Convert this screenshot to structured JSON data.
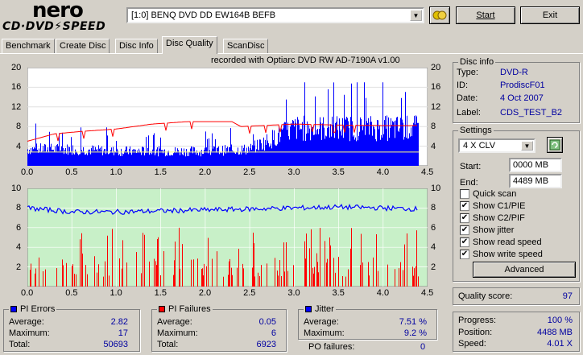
{
  "logo": {
    "top": "nero",
    "bottom": "CD·DVD⚡SPEED"
  },
  "drive": {
    "selected": "[1:0]  BENQ DVD DD EW164B BEFB"
  },
  "buttons": {
    "start": "Start",
    "exit": "Exit",
    "advanced": "Advanced"
  },
  "tabs": [
    "Benchmark",
    "Create Disc",
    "Disc Info",
    "Disc Quality",
    "ScanDisc"
  ],
  "chart_header": "recorded with Optiarc  DVD RW AD-7190A   v1.00",
  "disc_info": {
    "title": "Disc info",
    "type_label": "Type:",
    "type_value": "DVD-R",
    "id_label": "ID:",
    "id_value": "ProdiscF01",
    "date_label": "Date:",
    "date_value": "4 Oct 2007",
    "label_label": "Label:",
    "label_value": "CDS_TEST_B2"
  },
  "settings": {
    "title": "Settings",
    "speed": "4 X CLV",
    "start_label": "Start:",
    "start_value": "0000 MB",
    "end_label": "End:",
    "end_value": "4489 MB",
    "checks": [
      {
        "label": "Quick scan",
        "checked": false
      },
      {
        "label": "Show C1/PIE",
        "checked": true
      },
      {
        "label": "Show C2/PIF",
        "checked": true
      },
      {
        "label": "Show jitter",
        "checked": true
      },
      {
        "label": "Show read speed",
        "checked": true
      },
      {
        "label": "Show write speed",
        "checked": true
      }
    ]
  },
  "quality": {
    "label": "Quality score:",
    "value": "97"
  },
  "progress": {
    "progress_label": "Progress:",
    "progress_value": "100 %",
    "position_label": "Position:",
    "position_value": "4488 MB",
    "speed_label": "Speed:",
    "speed_value": "4.01 X"
  },
  "pi_errors": {
    "title": "PI Errors",
    "avg_label": "Average:",
    "avg": "2.82",
    "max_label": "Maximum:",
    "max": "17",
    "total_label": "Total:",
    "total": "50693",
    "color": "#0000ff"
  },
  "pi_failures": {
    "title": "PI Failures",
    "avg_label": "Average:",
    "avg": "0.05",
    "max_label": "Maximum:",
    "max": "6",
    "total_label": "Total:",
    "total": "6923",
    "color": "#ff0000"
  },
  "jitter": {
    "title": "Jitter",
    "avg_label": "Average:",
    "avg": "7.51 %",
    "max_label": "Maximum:",
    "max": "9.2 %",
    "po_label": "PO failures:",
    "po": "0",
    "color": "#0000ff"
  },
  "chart_data": [
    {
      "type": "area",
      "name": "PI Errors chart",
      "x_ticks": [
        "0.0",
        "0.5",
        "1.0",
        "1.5",
        "2.0",
        "2.5",
        "3.0",
        "3.5",
        "4.0",
        "4.5"
      ],
      "y_ticks_left": [
        "20",
        "16",
        "12",
        "8",
        "4"
      ],
      "y_ticks_right": [
        "20",
        "16",
        "12",
        "8",
        "4"
      ],
      "xlim": [
        0,
        4.5
      ],
      "ylim": [
        0,
        20
      ],
      "pie_profile": [
        [
          0,
          4
        ],
        [
          0.5,
          4
        ],
        [
          1.0,
          3.5
        ],
        [
          1.5,
          3.5
        ],
        [
          2.0,
          3.5
        ],
        [
          2.5,
          4
        ],
        [
          2.7,
          6
        ],
        [
          3.0,
          9
        ],
        [
          3.5,
          9
        ],
        [
          4.0,
          9
        ],
        [
          4.4,
          9
        ]
      ],
      "speed_profile": [
        [
          0,
          5
        ],
        [
          0.3,
          6.5
        ],
        [
          0.6,
          7
        ],
        [
          1.0,
          7.5
        ],
        [
          1.4,
          8.5
        ],
        [
          1.8,
          9
        ],
        [
          2.3,
          9
        ],
        [
          2.4,
          8
        ],
        [
          3.0,
          8.5
        ],
        [
          3.5,
          8.3
        ],
        [
          4.0,
          8.2
        ],
        [
          4.4,
          8.2
        ]
      ],
      "colors": {
        "bars": "#0000ff",
        "speed": "#ff0000",
        "baseline": "#ffff80",
        "bg": "#ffffff"
      }
    },
    {
      "type": "bar",
      "name": "PI Failures / Jitter chart",
      "x_ticks": [
        "0.0",
        "0.5",
        "1.0",
        "1.5",
        "2.0",
        "2.5",
        "3.0",
        "3.5",
        "4.0",
        "4.5"
      ],
      "y_ticks_left": [
        "10",
        "8",
        "6",
        "4",
        "2"
      ],
      "y_ticks_right": [
        "10",
        "8",
        "6",
        "4",
        "2"
      ],
      "xlim": [
        0,
        4.5
      ],
      "ylim": [
        0,
        10
      ],
      "jitter_profile": [
        [
          0,
          8
        ],
        [
          0.5,
          7.6
        ],
        [
          1.0,
          7.6
        ],
        [
          1.5,
          7.7
        ],
        [
          2.0,
          7.8
        ],
        [
          2.5,
          7.9
        ],
        [
          3.0,
          8.0
        ],
        [
          3.5,
          8.1
        ],
        [
          4.0,
          8.0
        ],
        [
          4.4,
          7.9
        ]
      ],
      "colors": {
        "bars": "#ff0000",
        "jitter": "#0000ff",
        "bg": "#c8f0c8"
      }
    }
  ]
}
